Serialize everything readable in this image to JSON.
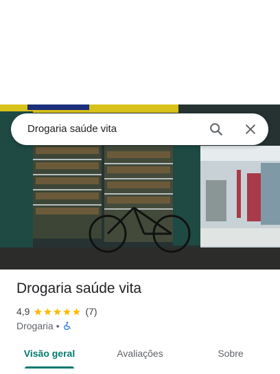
{
  "search": {
    "query": "Drogaria saúde vita"
  },
  "place": {
    "name": "Drogaria saúde vita",
    "rating": "4,9",
    "rating_value": 4.9,
    "review_count": "(7)",
    "category": "Drogaria",
    "separator": "•",
    "accessibility_icon": "wheelchair-icon"
  },
  "tabs": [
    {
      "label": "Visão geral",
      "active": true
    },
    {
      "label": "Avaliações",
      "active": false
    },
    {
      "label": "Sobre",
      "active": false
    }
  ],
  "colors": {
    "accent": "#01796f",
    "star": "#fbbc04",
    "accessibility": "#1a73e8"
  }
}
